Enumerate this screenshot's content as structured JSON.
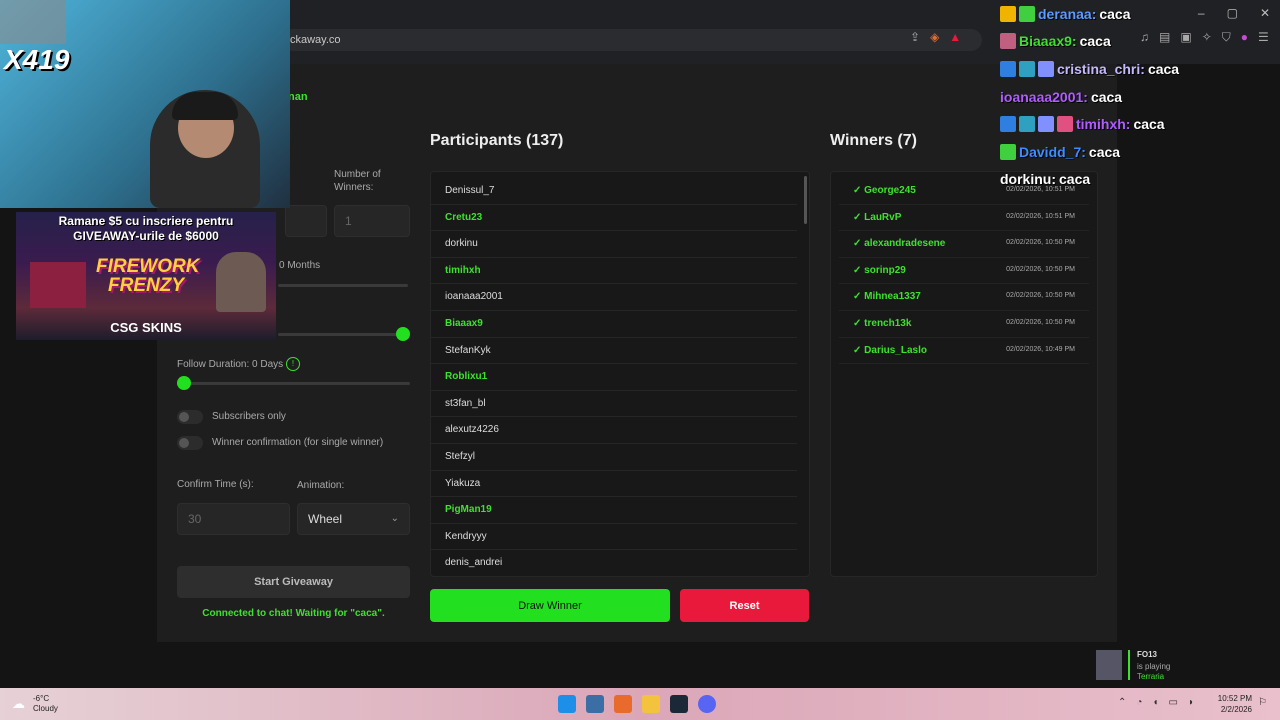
{
  "browser": {
    "url": "ckaway.co",
    "window_controls": [
      "–",
      "▢",
      "✕"
    ]
  },
  "streamer": {
    "viewer_count": "X419",
    "partial_name": "nan"
  },
  "ad": {
    "line1": "Ramane $5 cu inscriere pentru",
    "line2": "GIVEAWAY-urile de $6000",
    "title": "FIREWORK FRENZY",
    "brand": "CSG SKINS"
  },
  "settings": {
    "number_of_winners_label": "Number of Winners:",
    "number_of_winners_value": "1",
    "months_text": "0 Months",
    "follow_duration_label": "Follow Duration: 0 Days",
    "subscribers_only": "Subscribers only",
    "winner_confirmation": "Winner confirmation (for single winner)",
    "confirm_time_label": "Confirm Time (s):",
    "confirm_time_value": "30",
    "animation_label": "Animation:",
    "animation_value": "Wheel",
    "start_button": "Start Giveaway",
    "status": "Connected to chat! Waiting for \"caca\"."
  },
  "participants": {
    "title": "Participants (137)",
    "items": [
      {
        "name": "Denissul_7",
        "highlight": false
      },
      {
        "name": "Cretu23",
        "highlight": true
      },
      {
        "name": "dorkinu",
        "highlight": false
      },
      {
        "name": "timihxh",
        "highlight": true
      },
      {
        "name": "ioanaaa2001",
        "highlight": false
      },
      {
        "name": "Biaaax9",
        "highlight": true
      },
      {
        "name": "StefanKyk",
        "highlight": false
      },
      {
        "name": "Roblixu1",
        "highlight": true
      },
      {
        "name": "st3fan_bl",
        "highlight": false
      },
      {
        "name": "alexutz4226",
        "highlight": false
      },
      {
        "name": "Stefzyl",
        "highlight": false
      },
      {
        "name": "Yiakuza",
        "highlight": false
      },
      {
        "name": "PigMan19",
        "highlight": true
      },
      {
        "name": "Kendryyy",
        "highlight": false
      },
      {
        "name": "denis_andrei",
        "highlight": false
      }
    ],
    "draw_button": "Draw Winner",
    "reset_button": "Reset"
  },
  "winners": {
    "title": "Winners (7)",
    "items": [
      {
        "name": "✓ George245",
        "time": "02/02/2026, 10:51 PM"
      },
      {
        "name": "✓ LauRvP",
        "time": "02/02/2026, 10:51 PM"
      },
      {
        "name": "✓ alexandradesene",
        "time": "02/02/2026, 10:50 PM"
      },
      {
        "name": "✓ sorinp29",
        "time": "02/02/2026, 10:50 PM"
      },
      {
        "name": "✓ Mihnea1337",
        "time": "02/02/2026, 10:50 PM"
      },
      {
        "name": "✓ trench13k",
        "time": "02/02/2026, 10:50 PM"
      },
      {
        "name": "✓ Darius_Laslo",
        "time": "02/02/2026, 10:49 PM"
      }
    ]
  },
  "chat": [
    {
      "user": "deranaa:",
      "msg": "caca",
      "color": "#5b9bff",
      "badges": [
        "#f0b400",
        "#3fcf3f"
      ]
    },
    {
      "user": "Biaaax9:",
      "msg": "caca",
      "color": "#3fe030",
      "badges": [
        "#c06080"
      ]
    },
    {
      "user": "cristina_chri:",
      "msg": "caca",
      "color": "#c5b8ff",
      "badges": [
        "#2f7fe0",
        "#2fa0c0",
        "#8090ff"
      ]
    },
    {
      "user": "ioanaaa2001:",
      "msg": "caca",
      "color": "#b05cff",
      "badges": []
    },
    {
      "user": "timihxh:",
      "msg": "caca",
      "color": "#b05cff",
      "badges": [
        "#2f7fe0",
        "#2fa0c0",
        "#8090ff",
        "#e05080"
      ]
    },
    {
      "user": "Davidd_7:",
      "msg": "caca",
      "color": "#3c8dff",
      "badges": [
        "#3fcf3f"
      ]
    },
    {
      "user": "dorkinu:",
      "msg": "caca",
      "color": "#ffffff",
      "badges": []
    }
  ],
  "notification": {
    "user": "FO13",
    "status": "is playing",
    "game": "Terraria"
  },
  "taskbar": {
    "temperature": "-6°C",
    "weather": "Cloudy",
    "time": "10:52 PM",
    "date": "2/2/2026"
  },
  "colors": {
    "accent_green": "#22e01f",
    "reset_red": "#e8193a"
  }
}
